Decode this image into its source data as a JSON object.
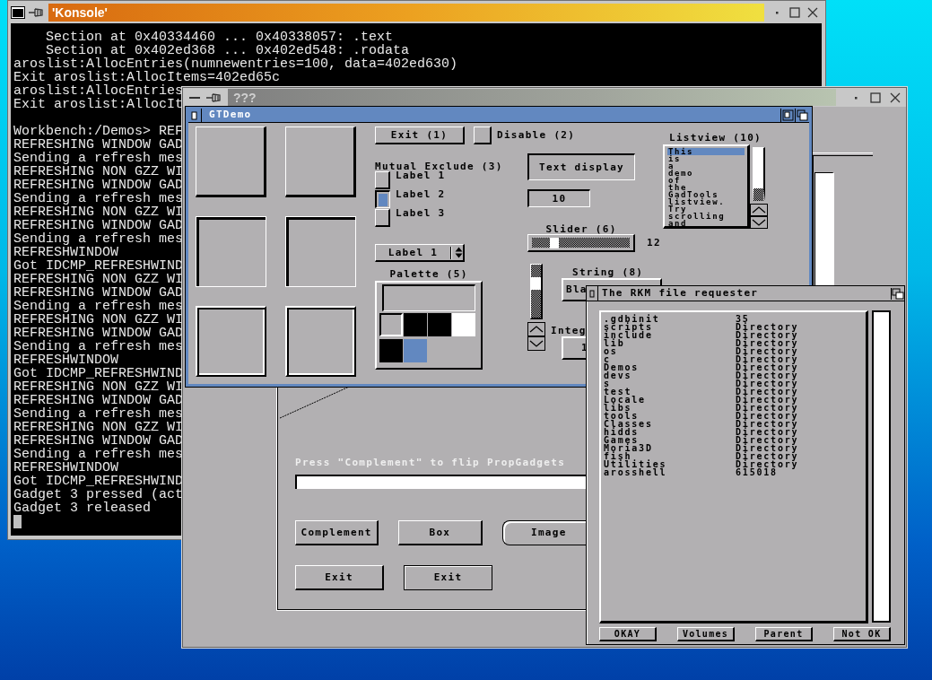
{
  "konsole": {
    "title": "'Konsole'",
    "blocks": [
      [
        "    Section at 0x40334460 ... 0x40338057: .text",
        "    Section at 0x402ed368 ... 0x402ed548: .rodata",
        "aroslist:AllocEntries(numnewentries=100, data=402ed630)",
        "Exit aroslist:AllocItems=402ed65c",
        "aroslist:AllocEntries",
        "Exit aroslist:AllocIt"
      ],
      [
        "Workbench:/Demos> REF",
        "REFRESHING WINDOW GAD",
        "Sending a refresh mes",
        "REFRESHING NON GZZ WI",
        "REFRESHING WINDOW GAD",
        "Sending a refresh mes",
        "REFRESHING NON GZZ WI",
        "REFRESHING WINDOW GAD",
        "Sending a refresh mes",
        "REFRESHWINDOW",
        "Got IDCMP_REFRESHWIND",
        "REFRESHING NON GZZ WI",
        "REFRESHING WINDOW GAD",
        "Sending a refresh mes",
        "REFRESHING NON GZZ WI",
        "REFRESHING WINDOW GAD",
        "Sending a refresh mes",
        "REFRESHWINDOW",
        "Got IDCMP_REFRESHWIND",
        "REFRESHING NON GZZ WI",
        "REFRESHING WINDOW GAD",
        "Sending a refresh mes",
        "REFRESHING NON GZZ WI",
        "REFRESHING WINDOW GAD",
        "Sending a refresh mes",
        "REFRESHWINDOW",
        "Got IDCMP_REFRESHWIND",
        "Gadget 3 pressed (act",
        "Gadget 3 released"
      ]
    ]
  },
  "demo_window": {
    "title": "???",
    "message": "Press \"Complement\" to flip PropGadgets",
    "buttons": [
      {
        "label": "Complement",
        "kind": "raised"
      },
      {
        "label": "Box",
        "kind": "raised"
      },
      {
        "label": "Image",
        "kind": "rounded"
      },
      {
        "label": "Exit",
        "kind": "raised"
      },
      {
        "label": "Exit",
        "kind": "flat"
      }
    ]
  },
  "gtdemo": {
    "title": "GTDemo",
    "exit_button": "Exit (1)",
    "disable": {
      "label": "Disable (2)",
      "checked": false
    },
    "mutual_exclude": {
      "label": "Mutual Exclude (3)",
      "options": [
        {
          "label": "Label 1",
          "selected": false
        },
        {
          "label": "Label 2",
          "selected": true
        },
        {
          "label": "Label 3",
          "selected": false
        }
      ]
    },
    "cycle": {
      "value": "Label 1"
    },
    "palette": {
      "label": "Palette (5)",
      "colors": [
        {
          "color": "#b2b0b2",
          "selected": true
        },
        {
          "color": "#000000",
          "selected": false
        },
        {
          "color": "#000000",
          "selected": false
        },
        {
          "color": "#ffffff",
          "selected": false
        },
        {
          "color": "#000000",
          "selected": false
        },
        {
          "color": "#6288c0",
          "selected": false
        }
      ]
    },
    "text_display": "Text display",
    "number_display": "10",
    "slider": {
      "label": "Slider (6)",
      "level": 0.2,
      "reading": "12"
    },
    "string": {
      "label": "String (8)",
      "value": "Bla"
    },
    "integer": {
      "label": "Integ",
      "value": "1"
    },
    "listview": {
      "label": "Listview (10)",
      "items": [
        {
          "label": "This",
          "selected": true
        },
        {
          "label": "is",
          "selected": false
        },
        {
          "label": "a",
          "selected": false
        },
        {
          "label": "demo",
          "selected": false
        },
        {
          "label": "of",
          "selected": false
        },
        {
          "label": "the",
          "selected": false
        },
        {
          "label": "GadTools",
          "selected": false
        },
        {
          "label": "listview.",
          "selected": false
        },
        {
          "label": "Try",
          "selected": false
        },
        {
          "label": "scrolling",
          "selected": false
        },
        {
          "label": "and",
          "selected": false
        }
      ]
    }
  },
  "file_requester": {
    "title": "The RKM file requester",
    "entries": [
      {
        "name": ".gdbinit",
        "size": "35"
      },
      {
        "name": "scripts",
        "size": "Directory"
      },
      {
        "name": "include",
        "size": "Directory"
      },
      {
        "name": "lib",
        "size": "Directory"
      },
      {
        "name": "os",
        "size": "Directory"
      },
      {
        "name": "c",
        "size": "Directory"
      },
      {
        "name": "Demos",
        "size": "Directory"
      },
      {
        "name": "devs",
        "size": "Directory"
      },
      {
        "name": "s",
        "size": "Directory"
      },
      {
        "name": "test",
        "size": "Directory"
      },
      {
        "name": "Locale",
        "size": "Directory"
      },
      {
        "name": "libs",
        "size": "Directory"
      },
      {
        "name": "tools",
        "size": "Directory"
      },
      {
        "name": "Classes",
        "size": "Directory"
      },
      {
        "name": "hidds",
        "size": "Directory"
      },
      {
        "name": "Games",
        "size": "Directory"
      },
      {
        "name": "Moria3D",
        "size": "Directory"
      },
      {
        "name": "fish",
        "size": "Directory"
      },
      {
        "name": "Utilities",
        "size": "Directory"
      },
      {
        "name": "arosshell",
        "size": "615018"
      }
    ],
    "buttons": [
      "OKAY",
      "Volumes",
      "Parent",
      "Not OK"
    ]
  }
}
